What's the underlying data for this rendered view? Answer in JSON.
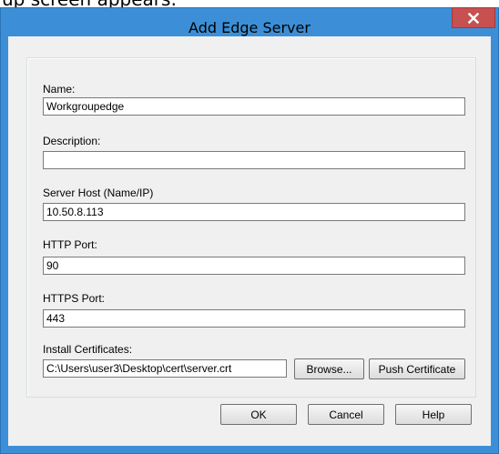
{
  "caption": "up screen appears:",
  "window": {
    "title": "Add Edge Server",
    "close_glyph": "x",
    "close_icon": "close-icon"
  },
  "form": {
    "name_label": "Name:",
    "name_value": "Workgroupedge",
    "description_label": "Description:",
    "description_value": "",
    "host_label": "Server Host (Name/IP)",
    "host_value": "10.50.8.113",
    "http_label": "HTTP Port:",
    "http_value": "90",
    "https_label": "HTTPS Port:",
    "https_value": "443",
    "cert_label": "Install Certificates:",
    "cert_value": "C:\\Users\\user3\\Desktop\\cert\\server.crt",
    "browse_label": "Browse...",
    "push_label": "Push Certificate"
  },
  "buttons": {
    "ok": "OK",
    "cancel": "Cancel",
    "help": "Help"
  }
}
